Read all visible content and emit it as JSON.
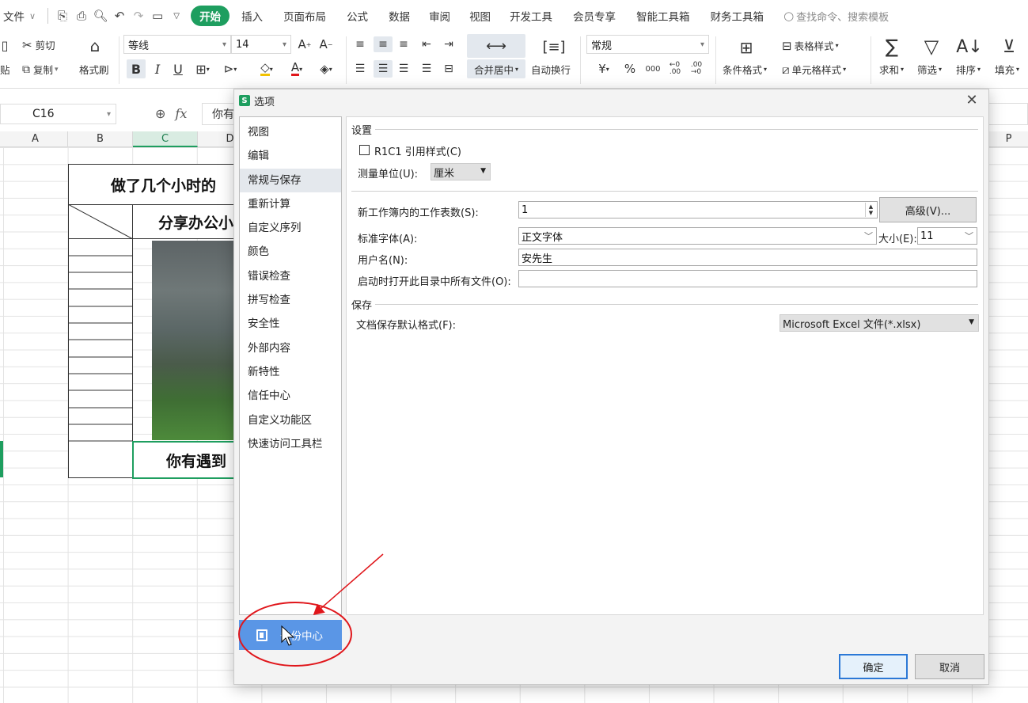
{
  "menu": {
    "file_label": "文件",
    "tabs": [
      "开始",
      "插入",
      "页面布局",
      "公式",
      "数据",
      "审阅",
      "视图",
      "开发工具",
      "会员专享",
      "智能工具箱",
      "财务工具箱"
    ],
    "search_placeholder": "查找命令、搜索模板"
  },
  "ribbon": {
    "cut": "剪切",
    "copy": "复制",
    "paste_partial": "贴",
    "format_painter": "格式刷",
    "font_name": "等线",
    "font_size": "14",
    "merge_center": "合并居中",
    "wrap_text": "自动换行",
    "number_format": "常规",
    "percent": "%",
    "thousands": "000",
    "cond_format": "条件格式",
    "table_style": "表格样式",
    "cell_style": "单元格样式",
    "sum": "求和",
    "filter": "筛选",
    "sort": "排序",
    "fill": "填充"
  },
  "formula_bar": {
    "cell_ref": "C16",
    "content": "你有"
  },
  "sheet": {
    "columns": [
      "A",
      "B",
      "C",
      "D",
      "P"
    ],
    "title_text": "做了几个小时的",
    "subtitle_text": "分享办公小",
    "bottom_text": "你有遇到"
  },
  "dialog": {
    "title": "选项",
    "logo": "S",
    "nav": [
      "视图",
      "编辑",
      "常规与保存",
      "重新计算",
      "自定义序列",
      "颜色",
      "错误检查",
      "拼写检查",
      "安全性",
      "外部内容",
      "新特性",
      "信任中心",
      "自定义功能区",
      "快速访问工具栏"
    ],
    "nav_selected_index": 2,
    "backup_center": "备份中心",
    "section_settings": "设置",
    "r1c1_label": "R1C1 引用样式(C)",
    "unit_label": "测量单位(U):",
    "unit_value": "厘米",
    "sheets_label": "新工作簿内的工作表数(S):",
    "sheets_value": "1",
    "advanced_button": "高级(V)...",
    "font_label": "标准字体(A):",
    "font_value": "正文字体",
    "size_label": "大小(E):",
    "size_value": "11",
    "username_label": "用户名(N):",
    "username_value": "安先生",
    "startup_label": "启动时打开此目录中所有文件(O):",
    "startup_value": "",
    "section_save": "保存",
    "save_format_label": "文档保存默认格式(F):",
    "save_format_value": "Microsoft Excel 文件(*.xlsx)",
    "ok_button": "确定",
    "cancel_button": "取消"
  },
  "colors": {
    "accent_green": "#1e9e5f",
    "backup_blue": "#5a96e6",
    "annotation_red": "#e0161b"
  }
}
